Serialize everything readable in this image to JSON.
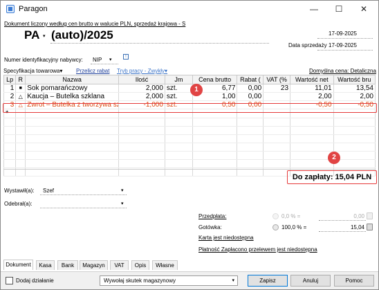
{
  "window": {
    "title": "Paragon",
    "minimize": "—",
    "maximize": "☐",
    "close": "✕"
  },
  "document": {
    "note": "Dokument liczony według cen brutto w walucie PLN, sprzedaż krajowa - S",
    "type": "PA",
    "type_arrow": "▾",
    "number": "(auto)/2025",
    "issue_date": "17-09-2025",
    "sale_date_label": "Data sprzedaży",
    "sale_date": "17-09-2025"
  },
  "buyer": {
    "id_label_line1": "Numer identyfikacyjny nabywcy:",
    "id_label_line2": "",
    "id_type": "NIP",
    "id_type_arrow": "▾",
    "info_button": "!"
  },
  "toolbar": {
    "spec_label": "Specyfikacja towarowa",
    "spec_arrow": "▾",
    "rabat_label": "Przelicz rabat",
    "tryb_label": "Tryb pracy - Zwykły",
    "tryb_arrow": "▾",
    "cena_label": "Domyślna cena: Detaliczna"
  },
  "table": {
    "columns": [
      "Lp",
      "R",
      "Nazwa",
      "Ilość",
      "Jm",
      "Cena brutto",
      "Rabat (",
      "VAT (%",
      "Wartość net",
      "Wartość bru"
    ],
    "rows": [
      {
        "lp": "1",
        "r": "■",
        "name": "Sok pomarańczowy",
        "qty": "2,000",
        "unit": "szt.",
        "price": "6,77",
        "rabat": "0,00",
        "vat": "23",
        "net": "11,01",
        "gross": "13,54"
      },
      {
        "lp": "2",
        "r": "△",
        "name": "Kaucja – Butelka szklana",
        "qty": "2,000",
        "unit": "szt.",
        "price": "1,00",
        "rabat": "0,00",
        "vat": "",
        "net": "2,00",
        "gross": "2,00"
      },
      {
        "lp": "3",
        "r": "△",
        "name": "Zwrot – Butelka z tworzywa szt",
        "qty": "-1,000",
        "unit": "szt.",
        "price": "0,50",
        "rabat": "0,00",
        "vat": "",
        "net": "-0,50",
        "gross": "-0,50"
      }
    ],
    "new_row_marker": "*"
  },
  "badges": {
    "b1": "1",
    "b2": "2"
  },
  "summary": {
    "to_pay": "Do zapłaty: 15,04 PLN"
  },
  "footer_fields": {
    "wystawil_label": "Wystawił(a):",
    "wystawil_value": "Szef",
    "odebral_label": "Odebrał(a):",
    "odebral_value": "",
    "arrow": "▾"
  },
  "payment": {
    "przedplata_label": "Przedpłata:",
    "przedplata_pct": "0,0 % =",
    "przedplata_amount": "0,00",
    "gotowka_label": "Gotówka:",
    "gotowka_pct": "100,0 % =",
    "gotowka_amount": "15,04",
    "karta_label": "Karta jest niedostępna",
    "platnosc_label": "Płatność Zapłacono przelewem jest niedostępna"
  },
  "tabs": [
    "Dokument",
    "Kasa",
    "Bank",
    "Magazyn",
    "VAT",
    "Opis",
    "Własne"
  ],
  "bottom_bar": {
    "checkbox_label": "Dodaj działanie",
    "combo_value": "Wywołaj skutek magazynowy",
    "combo_arrow": "▾",
    "zapisz": "Zapisz",
    "anuluj": "Anuluj",
    "pomoc": "Pomoc"
  },
  "colors": {
    "highlight_red": "#e53a3a",
    "selected_row_text": "#d9480f",
    "link_blue": "#1a3c99",
    "badge_red": "#e14444"
  }
}
